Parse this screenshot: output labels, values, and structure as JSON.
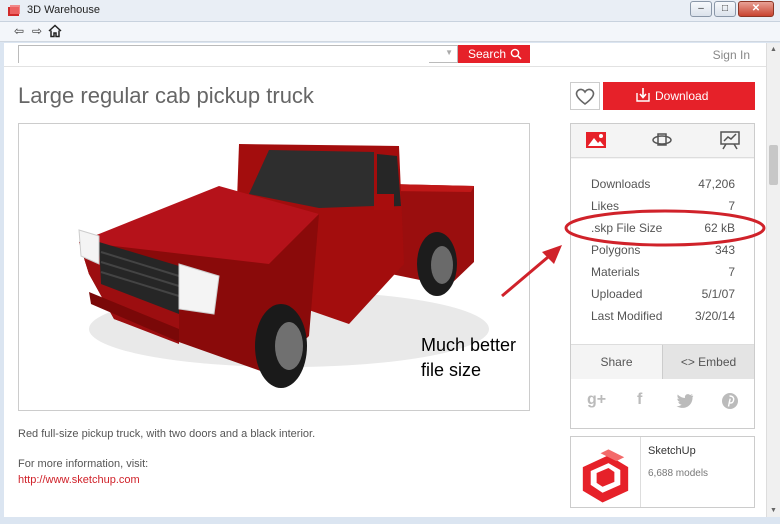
{
  "window": {
    "title": "3D Warehouse"
  },
  "search": {
    "placeholder": "",
    "button_label": "Search"
  },
  "header": {
    "sign_in_label": "Sign In"
  },
  "model": {
    "title": "Large regular cab pickup truck",
    "description": "Red full-size pickup truck, with two doors and a black interior.",
    "more_info_label": "For more information, visit:",
    "more_info_link": "http://www.sketchup.com"
  },
  "actions": {
    "download_label": "Download"
  },
  "stats": [
    {
      "label": "Downloads",
      "value": "47,206"
    },
    {
      "label": "Likes",
      "value": "7"
    },
    {
      "label": ".skp File Size",
      "value": "62 kB"
    },
    {
      "label": "Polygons",
      "value": "343"
    },
    {
      "label": "Materials",
      "value": "7"
    },
    {
      "label": "Uploaded",
      "value": "5/1/07"
    },
    {
      "label": "Last Modified",
      "value": "3/20/14"
    }
  ],
  "share": {
    "share_label": "Share",
    "embed_label": "<> Embed"
  },
  "social": {
    "google_plus": "g+",
    "facebook": "f"
  },
  "owner": {
    "name": "SketchUp",
    "models_label": "6,688 models"
  },
  "annotation": {
    "line1": "Much better",
    "line2": "file size"
  },
  "colors": {
    "accent": "#e62129",
    "annotation": "#d0222a"
  },
  "icons": [
    "back-arrow-icon",
    "forward-arrow-icon",
    "home-icon",
    "search-icon",
    "heart-icon",
    "download-icon",
    "image-icon",
    "3d-view-icon",
    "presentation-icon",
    "twitter-icon",
    "pinterest-icon"
  ]
}
